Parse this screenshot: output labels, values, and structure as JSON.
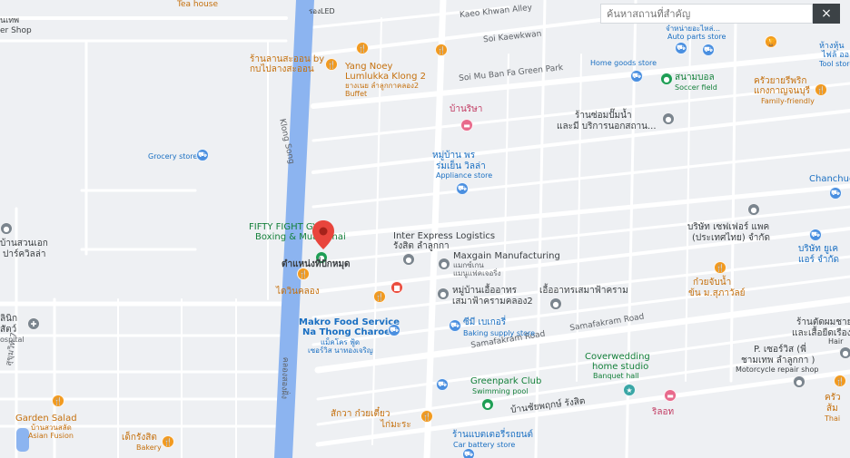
{
  "search": {
    "placeholder": "ค้นหาสถานที่สำคัญ"
  },
  "close_icon": "×",
  "roads": {
    "kaeo_khwan": "Kaeo Khwan Alley",
    "kaewkwan": "Soi Kaewkwan",
    "green_park": "Soi Mu Ban Fa Green Park",
    "samafakram_1": "Samafakram Road",
    "samafakram_2": "Samafakram Road",
    "canal": "Klong Song",
    "canal_thai": "คลองสองฝั่ง"
  },
  "pois": {
    "tea_house": "Tea house",
    "roong_led": "รองLED",
    "er_shop": "er Shop",
    "thepthai": "นเทพ",
    "lan_sa_on_1": "ร้านลานสะออน by",
    "lan_sa_on_2": "กบไปลางสะออน",
    "yang_noey_1": "Yang Noey",
    "yang_noey_2": "Lumlukka Klong 2",
    "yang_noey_3": "ยางเนย ลำลูกกาคลอง2",
    "yang_noey_4": "Buffet",
    "auto_parts_1": "จำหน่ายอะไหล่...",
    "auto_parts_2": "Auto parts store",
    "tool_store_1": "ห้างหุ้น",
    "tool_store_2": "ไฟล้ ออ",
    "tool_store_3": "Tool store",
    "home_goods": "Home goods store",
    "soccer_1": "สนามบอล",
    "soccer_2": "Soccer field",
    "family_1": "ครัวยายรีพริก",
    "family_2": "แกงกาญจนบุรี",
    "family_3": "Family-friendly",
    "bansiya": "บ้านริษา",
    "pump_1": "ร้านซ่อมปั๊มน้ำ",
    "pump_2": "และมี บริการนอกสถาน...",
    "grocery": "Grocery store",
    "appliance_1": "หมู่บ้าน พร",
    "appliance_2": "ร่มเย็น วิลล่า",
    "appliance_3": "Appliance store",
    "chanchue": "Chanchue",
    "fifty_fight_1": "FIFTY FIGHT GYM",
    "fifty_fight_2": "Boxing & Muay Thai",
    "inter_express_1": "Inter Express Logistics",
    "inter_express_2": "รังสิต ลำลูกกา",
    "selected_name": "ตำแหน่งที่ปักหมุด",
    "maxgain_1": "Maxgain Manufacturing",
    "maxgain_2": "แมกซ์เกน",
    "maxgain_3": "แมนูแฟคเจอริ่ง",
    "sapphire_1": "บริษัท เซฟเฟอร์ แพค",
    "sapphire_2": "(ประเทศไทย) จำกัด",
    "air_1": "บริษัท ยูเค",
    "air_2": "แอร์ จำกัด",
    "kuay_jab_1": "ก๋วยจับน้ำ",
    "kuay_jab_2": "ข้น ม.สุภาวัลย์",
    "daiwin": "ไดวินคลอง",
    "mu_ban_1": "หมู่บ้านเอื้ออาทร",
    "mu_ban_2": "เสมาฟ้าครามคลอง2",
    "ua_athon": "เอื้ออาทรเสมาฟ้าคราม",
    "makro_1": "Makro Food Service",
    "makro_2": "Na Thong Charoen",
    "makro_3": "แม็คโคร ฟู้ด",
    "makro_4": "เซอร์วิส นาทองเจริญ",
    "semi_bakery_1": "ซีมี เบเกอรี่",
    "semi_bakery_2": "Baking supply store",
    "khong_suan_1": "บ้านสวนเอก",
    "khong_suan_2": "ปาร์ควิลล่า",
    "hospital_1": "ลินิก",
    "hospital_2": "สัตว์",
    "hospital_3": "ospital",
    "sukhumvit": "สุขุมวิท 7",
    "coverwedding_1": "Coverwedding",
    "coverwedding_2": "home studio",
    "coverwedding_3": "Banquet hall",
    "motorcycle_1": "ร้านตัดผมชาย",
    "motorcycle_2": "และเสื้อยืดเรือง",
    "motorcycle_3": "Hair",
    "p_service_1": "P. เซอร์วิส (พี่",
    "p_service_2": "ชามเทพ ลำลูกกา )",
    "p_service_3": "Motorcycle repair shop",
    "greenpark_1": "Greenpark Club",
    "greenpark_2": "Swimming pool",
    "ban_chai": "บ้านชัยพฤกษ์ รังสิต",
    "rilot": "ริลอท",
    "khrua_1": "ครัว",
    "khrua_2": "ส้ม",
    "khrua_3": "Thai",
    "garden_salad_1": "Garden Salad",
    "garden_salad_2": "บ้านสวนสลัด",
    "garden_salad_3": "Asian Fusion",
    "sawa_1": "สักวา ก๋วยเตี๋ยว",
    "sawa_2": "ไก่มะระ",
    "battery_1": "ร้านแบตเตอรี่รถยนต์",
    "battery_2": "Car battery store",
    "dek_rangsit_1": "เด็กรังสิต",
    "dek_rangsit_2": "Bakery"
  },
  "colors": {
    "canal": "#8cb4f0",
    "road": "#ffffff",
    "land": "#eef0f3",
    "selected_pin": "#e8453c"
  }
}
